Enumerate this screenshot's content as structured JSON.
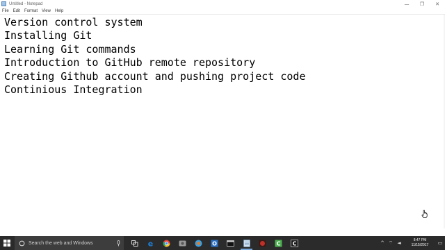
{
  "window": {
    "title": "Untitled - Notepad",
    "controls": {
      "minimize": "—",
      "maximize": "❐",
      "close": "✕"
    }
  },
  "menu": [
    "File",
    "Edit",
    "Format",
    "View",
    "Help"
  ],
  "document": {
    "lines": [
      "Version control system",
      "Installing Git",
      "Learning Git commands",
      "Introduction to GitHub remote repository",
      "Creating Github account and pushing project code",
      "Continious Integration"
    ]
  },
  "taskbar": {
    "search_placeholder": "Search the web and Windows",
    "apps": [
      {
        "icon": "task-view-icon",
        "color": "#ffffff"
      },
      {
        "icon": "edge-icon",
        "color": "#1e7fd6"
      },
      {
        "icon": "chrome-icon",
        "color": "#e8443a"
      },
      {
        "icon": "photos-icon",
        "color": "#9a9a9a"
      },
      {
        "icon": "browser-icon",
        "color": "#3aa0e0"
      },
      {
        "icon": "outlook-icon",
        "color": "#2a6fc4"
      },
      {
        "icon": "terminal-icon",
        "color": "#d0d0d0"
      },
      {
        "icon": "notepad-icon",
        "color": "#cfe0f0"
      },
      {
        "icon": "game-icon",
        "color": "#c0302a"
      },
      {
        "icon": "camtasia-icon",
        "color": "#4caf50"
      },
      {
        "icon": "ccleaner-icon",
        "color": "#ffffff"
      }
    ],
    "tray": {
      "expand": "^",
      "network": "⌔",
      "volume": "◄",
      "time": "8:47 PM",
      "date": "11/15/2017",
      "notifications": "▭"
    }
  }
}
